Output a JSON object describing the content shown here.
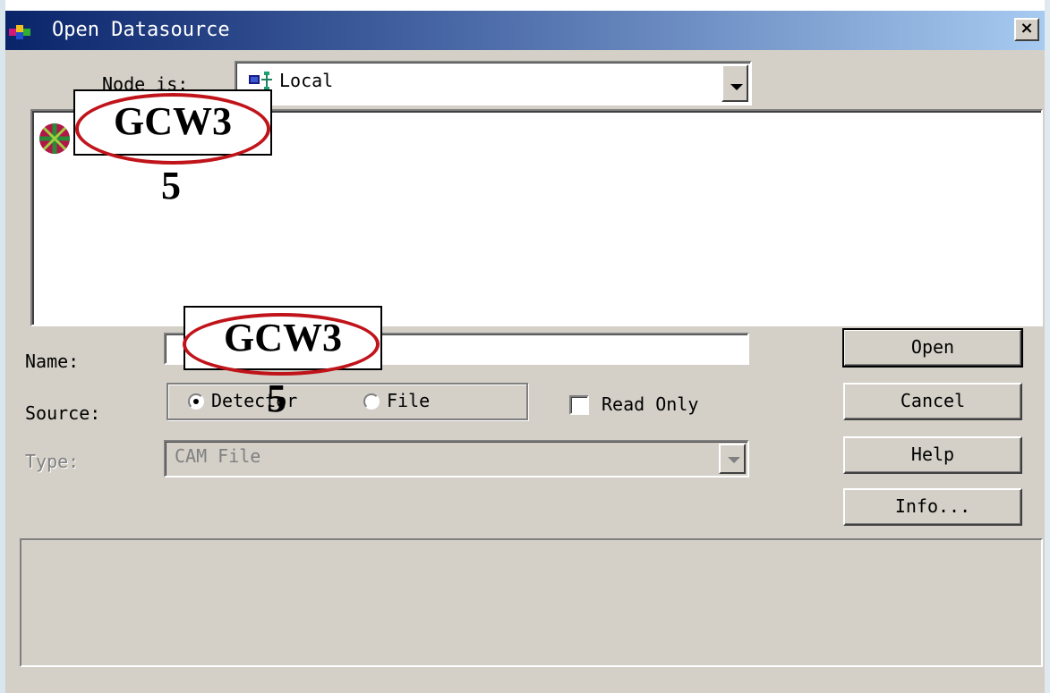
{
  "window": {
    "title": "Open Datasource",
    "close_label": "×"
  },
  "node": {
    "label": "Node is:",
    "value": "Local",
    "icon": "network-node-icon"
  },
  "name": {
    "label": "Name:",
    "value": ""
  },
  "source": {
    "label": "Source:",
    "options": [
      "Detector",
      "File"
    ],
    "selected": "Detector",
    "read_only_label": "Read Only",
    "read_only_checked": false
  },
  "type": {
    "label": "Type:",
    "value": "CAM File",
    "enabled": false
  },
  "buttons": {
    "open": "Open",
    "cancel": "Cancel",
    "help": "Help",
    "info": "Info..."
  },
  "annotations": {
    "callout_1_text": "GCW3",
    "callout_1_number": "5",
    "callout_2_text": "GCW3",
    "callout_2_number": "5",
    "highlight_color": "#c0141a"
  }
}
